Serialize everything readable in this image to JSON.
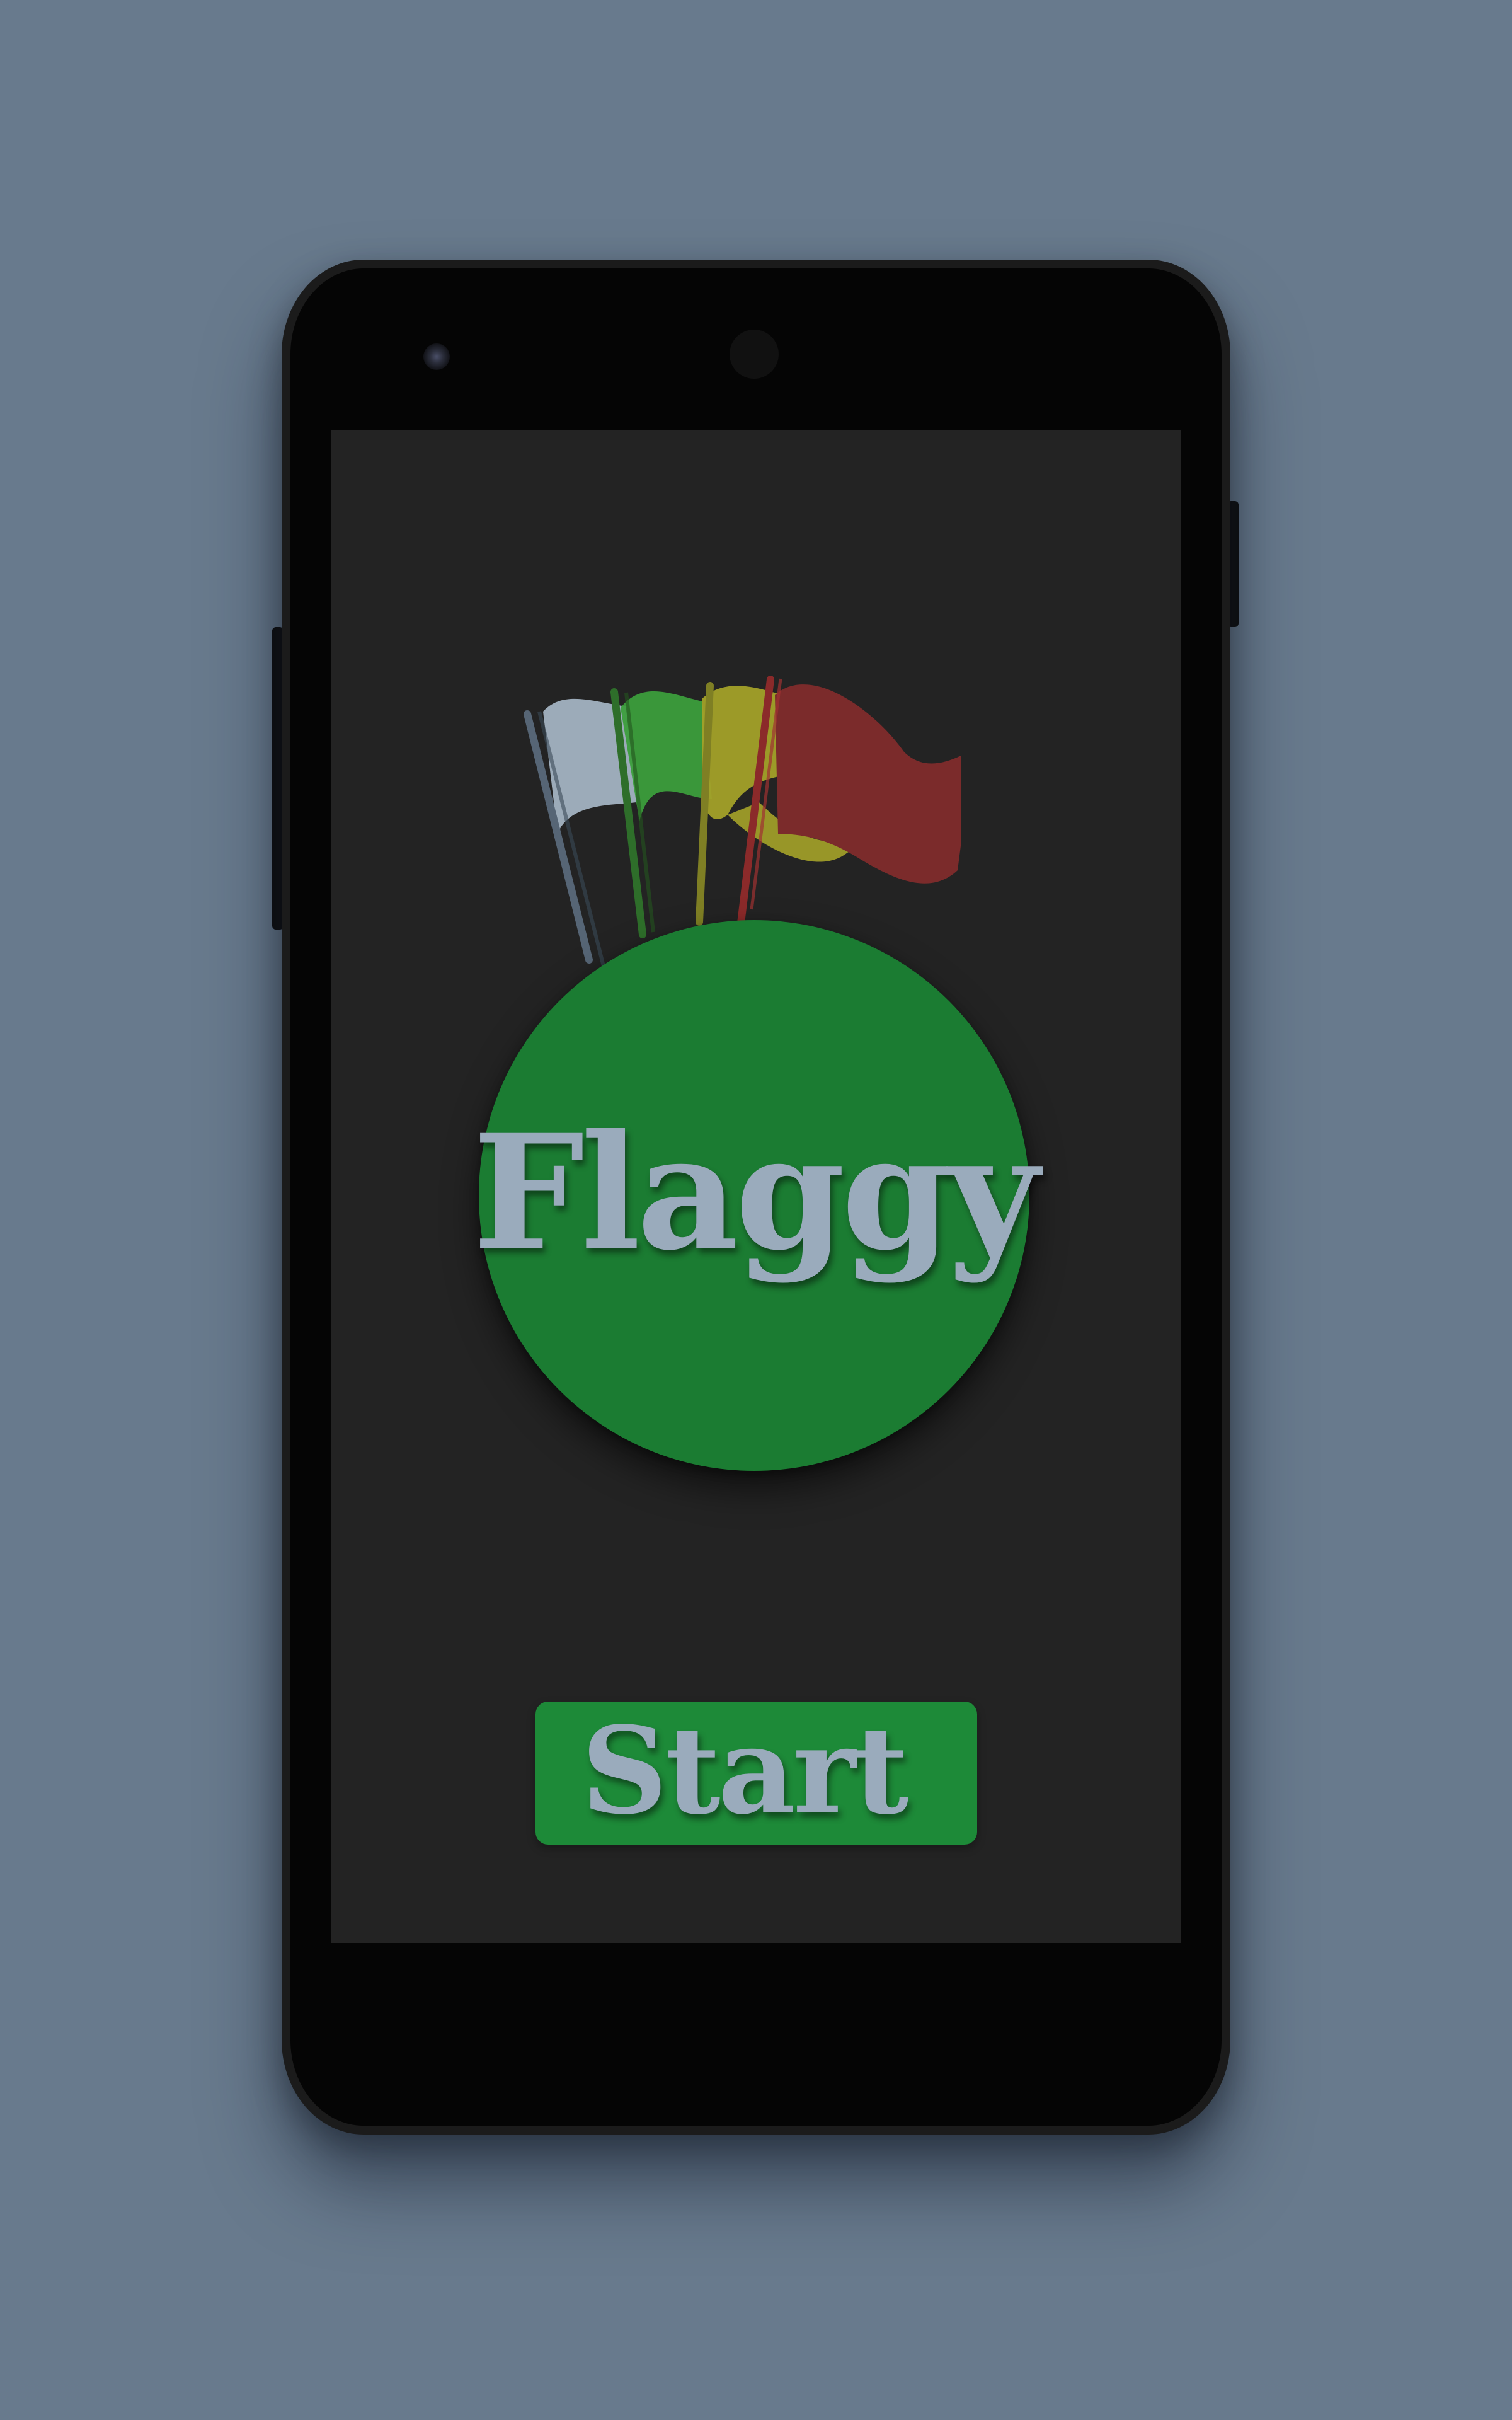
{
  "app": {
    "logo_text": "Flaggy",
    "start_label": "Start"
  },
  "flags": [
    {
      "name": "blue-grey-flag",
      "color": "#a3b3c2",
      "pole_color": "#566575"
    },
    {
      "name": "green-flag",
      "color": "#3c9e3c",
      "pole_color": "#2e6e2a"
    },
    {
      "name": "yellow-green-flag",
      "color": "#a3a129",
      "pole_color": "#7f7f24"
    },
    {
      "name": "red-flag",
      "color": "#7b2b2b",
      "pole_color": "#8b2a2a"
    }
  ],
  "colors": {
    "background": "#687a8d",
    "screen": "#232323",
    "logo_circle": "#1b7c32",
    "start_button": "#1d8a38",
    "text": "#9aabbc"
  }
}
